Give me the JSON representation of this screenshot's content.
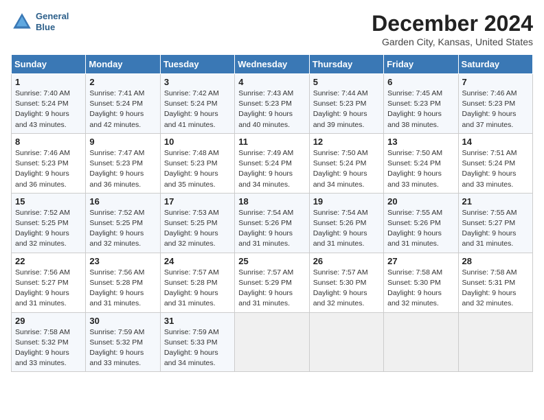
{
  "logo": {
    "line1": "General",
    "line2": "Blue"
  },
  "title": "December 2024",
  "subtitle": "Garden City, Kansas, United States",
  "days_of_week": [
    "Sunday",
    "Monday",
    "Tuesday",
    "Wednesday",
    "Thursday",
    "Friday",
    "Saturday"
  ],
  "weeks": [
    [
      {
        "day": "1",
        "sunrise": "7:40 AM",
        "sunset": "5:24 PM",
        "daylight": "9 hours and 43 minutes."
      },
      {
        "day": "2",
        "sunrise": "7:41 AM",
        "sunset": "5:24 PM",
        "daylight": "9 hours and 42 minutes."
      },
      {
        "day": "3",
        "sunrise": "7:42 AM",
        "sunset": "5:24 PM",
        "daylight": "9 hours and 41 minutes."
      },
      {
        "day": "4",
        "sunrise": "7:43 AM",
        "sunset": "5:23 PM",
        "daylight": "9 hours and 40 minutes."
      },
      {
        "day": "5",
        "sunrise": "7:44 AM",
        "sunset": "5:23 PM",
        "daylight": "9 hours and 39 minutes."
      },
      {
        "day": "6",
        "sunrise": "7:45 AM",
        "sunset": "5:23 PM",
        "daylight": "9 hours and 38 minutes."
      },
      {
        "day": "7",
        "sunrise": "7:46 AM",
        "sunset": "5:23 PM",
        "daylight": "9 hours and 37 minutes."
      }
    ],
    [
      {
        "day": "8",
        "sunrise": "7:46 AM",
        "sunset": "5:23 PM",
        "daylight": "9 hours and 36 minutes."
      },
      {
        "day": "9",
        "sunrise": "7:47 AM",
        "sunset": "5:23 PM",
        "daylight": "9 hours and 36 minutes."
      },
      {
        "day": "10",
        "sunrise": "7:48 AM",
        "sunset": "5:23 PM",
        "daylight": "9 hours and 35 minutes."
      },
      {
        "day": "11",
        "sunrise": "7:49 AM",
        "sunset": "5:24 PM",
        "daylight": "9 hours and 34 minutes."
      },
      {
        "day": "12",
        "sunrise": "7:50 AM",
        "sunset": "5:24 PM",
        "daylight": "9 hours and 34 minutes."
      },
      {
        "day": "13",
        "sunrise": "7:50 AM",
        "sunset": "5:24 PM",
        "daylight": "9 hours and 33 minutes."
      },
      {
        "day": "14",
        "sunrise": "7:51 AM",
        "sunset": "5:24 PM",
        "daylight": "9 hours and 33 minutes."
      }
    ],
    [
      {
        "day": "15",
        "sunrise": "7:52 AM",
        "sunset": "5:25 PM",
        "daylight": "9 hours and 32 minutes."
      },
      {
        "day": "16",
        "sunrise": "7:52 AM",
        "sunset": "5:25 PM",
        "daylight": "9 hours and 32 minutes."
      },
      {
        "day": "17",
        "sunrise": "7:53 AM",
        "sunset": "5:25 PM",
        "daylight": "9 hours and 32 minutes."
      },
      {
        "day": "18",
        "sunrise": "7:54 AM",
        "sunset": "5:26 PM",
        "daylight": "9 hours and 31 minutes."
      },
      {
        "day": "19",
        "sunrise": "7:54 AM",
        "sunset": "5:26 PM",
        "daylight": "9 hours and 31 minutes."
      },
      {
        "day": "20",
        "sunrise": "7:55 AM",
        "sunset": "5:26 PM",
        "daylight": "9 hours and 31 minutes."
      },
      {
        "day": "21",
        "sunrise": "7:55 AM",
        "sunset": "5:27 PM",
        "daylight": "9 hours and 31 minutes."
      }
    ],
    [
      {
        "day": "22",
        "sunrise": "7:56 AM",
        "sunset": "5:27 PM",
        "daylight": "9 hours and 31 minutes."
      },
      {
        "day": "23",
        "sunrise": "7:56 AM",
        "sunset": "5:28 PM",
        "daylight": "9 hours and 31 minutes."
      },
      {
        "day": "24",
        "sunrise": "7:57 AM",
        "sunset": "5:28 PM",
        "daylight": "9 hours and 31 minutes."
      },
      {
        "day": "25",
        "sunrise": "7:57 AM",
        "sunset": "5:29 PM",
        "daylight": "9 hours and 31 minutes."
      },
      {
        "day": "26",
        "sunrise": "7:57 AM",
        "sunset": "5:30 PM",
        "daylight": "9 hours and 32 minutes."
      },
      {
        "day": "27",
        "sunrise": "7:58 AM",
        "sunset": "5:30 PM",
        "daylight": "9 hours and 32 minutes."
      },
      {
        "day": "28",
        "sunrise": "7:58 AM",
        "sunset": "5:31 PM",
        "daylight": "9 hours and 32 minutes."
      }
    ],
    [
      {
        "day": "29",
        "sunrise": "7:58 AM",
        "sunset": "5:32 PM",
        "daylight": "9 hours and 33 minutes."
      },
      {
        "day": "30",
        "sunrise": "7:59 AM",
        "sunset": "5:32 PM",
        "daylight": "9 hours and 33 minutes."
      },
      {
        "day": "31",
        "sunrise": "7:59 AM",
        "sunset": "5:33 PM",
        "daylight": "9 hours and 34 minutes."
      },
      null,
      null,
      null,
      null
    ]
  ]
}
